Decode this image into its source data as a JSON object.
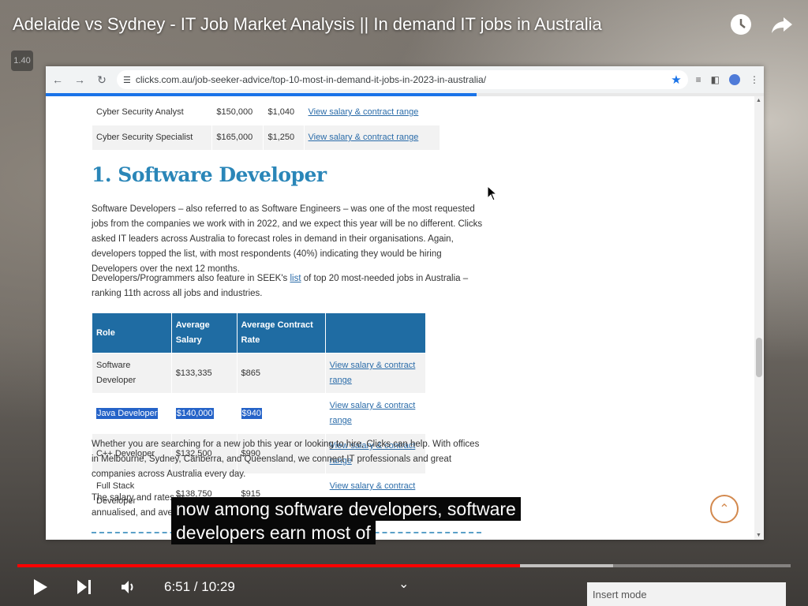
{
  "video": {
    "title": "Adelaide vs Sydney - IT Job Market Analysis || In demand IT jobs in Australia",
    "speed_badge": "1.40",
    "time_display": "6:51 / 10:29",
    "progress": 0.65,
    "caption_line1": "now among software developers, software",
    "caption_line2": "developers earn most of",
    "insert_mode": "Insert mode"
  },
  "browser": {
    "url": "clicks.com.au/job-seeker-advice/top-10-most-in-demand-it-jobs-in-2023-in-australia/",
    "load_progress": 0.6
  },
  "top_table": {
    "rows": [
      {
        "role": "Cyber Security Analyst",
        "salary": "$150,000",
        "rate": "$1,040",
        "link": "View salary & contract range"
      },
      {
        "role": "Cyber Security Specialist",
        "salary": "$165,000",
        "rate": "$1,250",
        "link": "View salary & contract range"
      }
    ]
  },
  "article": {
    "heading": "1. Software Developer",
    "para1": "Software Developers – also referred to as Software Engineers – was one of the most requested jobs from the companies we work with in 2022, and we expect this year will be no different. Clicks asked IT leaders across Australia to forecast roles in demand in their organisations. Again, developers topped the list, with most respondents (40%) indicating they would be hiring Developers over the next 12 months.",
    "para2_a": "Developers/Programmers also feature in SEEK's ",
    "para2_link": "list",
    "para2_b": " of top 20 most-needed jobs in Australia – ranking 11th across all jobs and industries.",
    "para3": "Whether you are searching for a new job this year or looking to hire, Clicks can help. With offices in Melbourne, Sydney, Canberra, and Queensland, we connect IT professionals and great companies across Australia every day.",
    "para4_a": "The salary and rates in",
    "para4_b": "annualised, and averag"
  },
  "dev_table": {
    "headers": [
      "Role",
      "Average Salary",
      "Average Contract Rate",
      ""
    ],
    "rows": [
      {
        "role": "Software Developer",
        "salary": "$133,335",
        "rate": "$865",
        "link": "View salary & contract range"
      },
      {
        "role": "Java Developer",
        "salary": "$140,000",
        "rate": "$940",
        "link": "View salary & contract range"
      },
      {
        "role": "C++ Developer",
        "salary": "$132,500",
        "rate": "$990",
        "link": "View salary & contract range"
      },
      {
        "role": "Full Stack Developer",
        "salary": "$138,750",
        "rate": "$915",
        "link": "View salary & contract range"
      }
    ]
  }
}
